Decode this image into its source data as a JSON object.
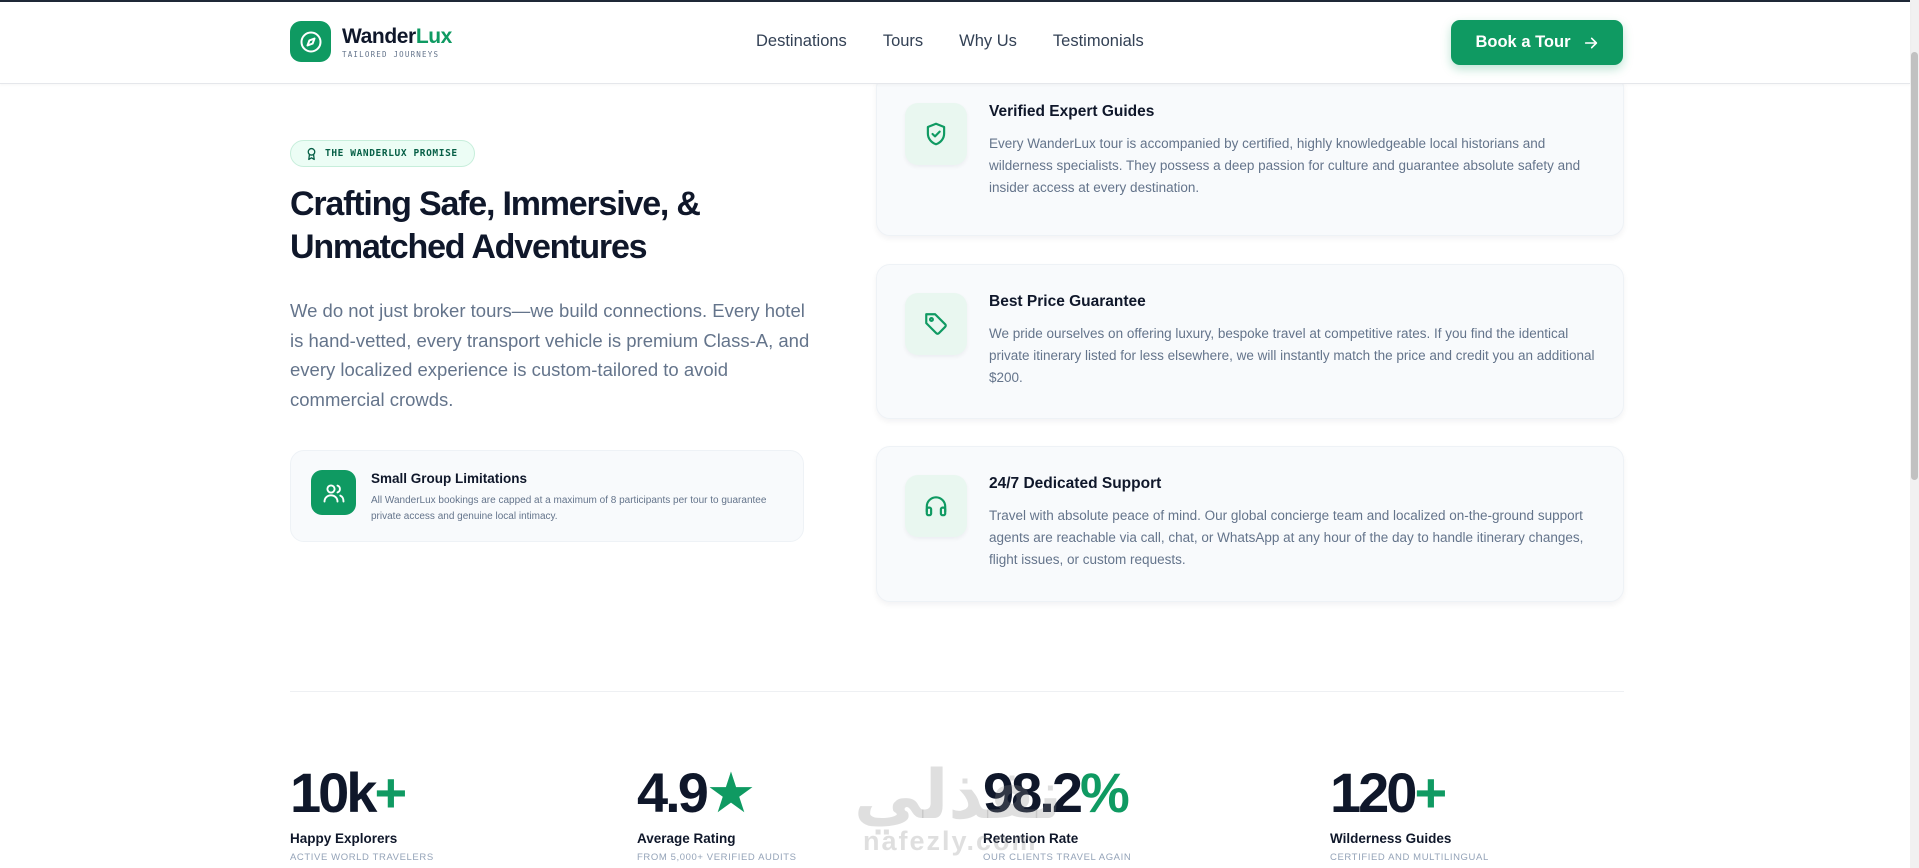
{
  "header": {
    "logo_name_part1": "Wander",
    "logo_name_part2": "Lux",
    "logo_tagline": "TAILORED JOURNEYS",
    "nav": [
      "Destinations",
      "Tours",
      "Why Us",
      "Testimonials"
    ],
    "cta_label": "Book a Tour"
  },
  "promise": {
    "badge": "THE WANDERLUX PROMISE",
    "headline_line1": "Crafting Safe, Immersive, &",
    "headline_line2": "Unmatched Adventures",
    "lead": "We do not just broker tours—we build connections. Every hotel is hand-vetted, every transport vehicle is premium Class-A, and every localized experience is custom-tailored to avoid commercial crowds.",
    "small_group": {
      "title": "Small Group Limitations",
      "text": "All WanderLux bookings are capped at a maximum of 8 participants per tour to guarantee private access and genuine local intimacy."
    }
  },
  "features": [
    {
      "icon": "shield-check-icon",
      "title": "Verified Expert Guides",
      "text": "Every WanderLux tour is accompanied by certified, highly knowledgeable local historians and wilderness specialists. They possess a deep passion for culture and guarantee absolute safety and insider access at every destination."
    },
    {
      "icon": "price-tag-icon",
      "title": "Best Price Guarantee",
      "text": "We pride ourselves on offering luxury, bespoke travel at competitive rates. If you find the identical private itinerary listed for less elsewhere, we will instantly match the price and credit you an additional $200."
    },
    {
      "icon": "headphones-icon",
      "title": "24/7 Dedicated Support",
      "text": "Travel with absolute peace of mind. Our global concierge team and localized on-the-ground support agents are reachable via call, chat, or WhatsApp at any hour of the day to handle itinerary changes, flight issues, or custom requests."
    }
  ],
  "stats": [
    {
      "value": "10k",
      "suffix": "+",
      "label": "Happy Explorers",
      "sub": "ACTIVE WORLD TRAVELERS"
    },
    {
      "value": "4.9",
      "suffix": "★",
      "label": "Average Rating",
      "sub": "FROM 5,000+ VERIFIED AUDITS"
    },
    {
      "value": "98.2",
      "suffix": "%",
      "label": "Retention Rate",
      "sub": "OUR CLIENTS TRAVEL AGAIN"
    },
    {
      "value": "120",
      "suffix": "+",
      "label": "Wilderness Guides",
      "sub": "CERTIFIED AND MULTILINGUAL"
    }
  ],
  "watermark": {
    "arabic": "نفذلي",
    "latin": "nafezly.com"
  },
  "colors": {
    "brand": "#0f9a62",
    "heading": "#0f172a",
    "body": "#64748b",
    "card_bg": "#f8fafc"
  }
}
